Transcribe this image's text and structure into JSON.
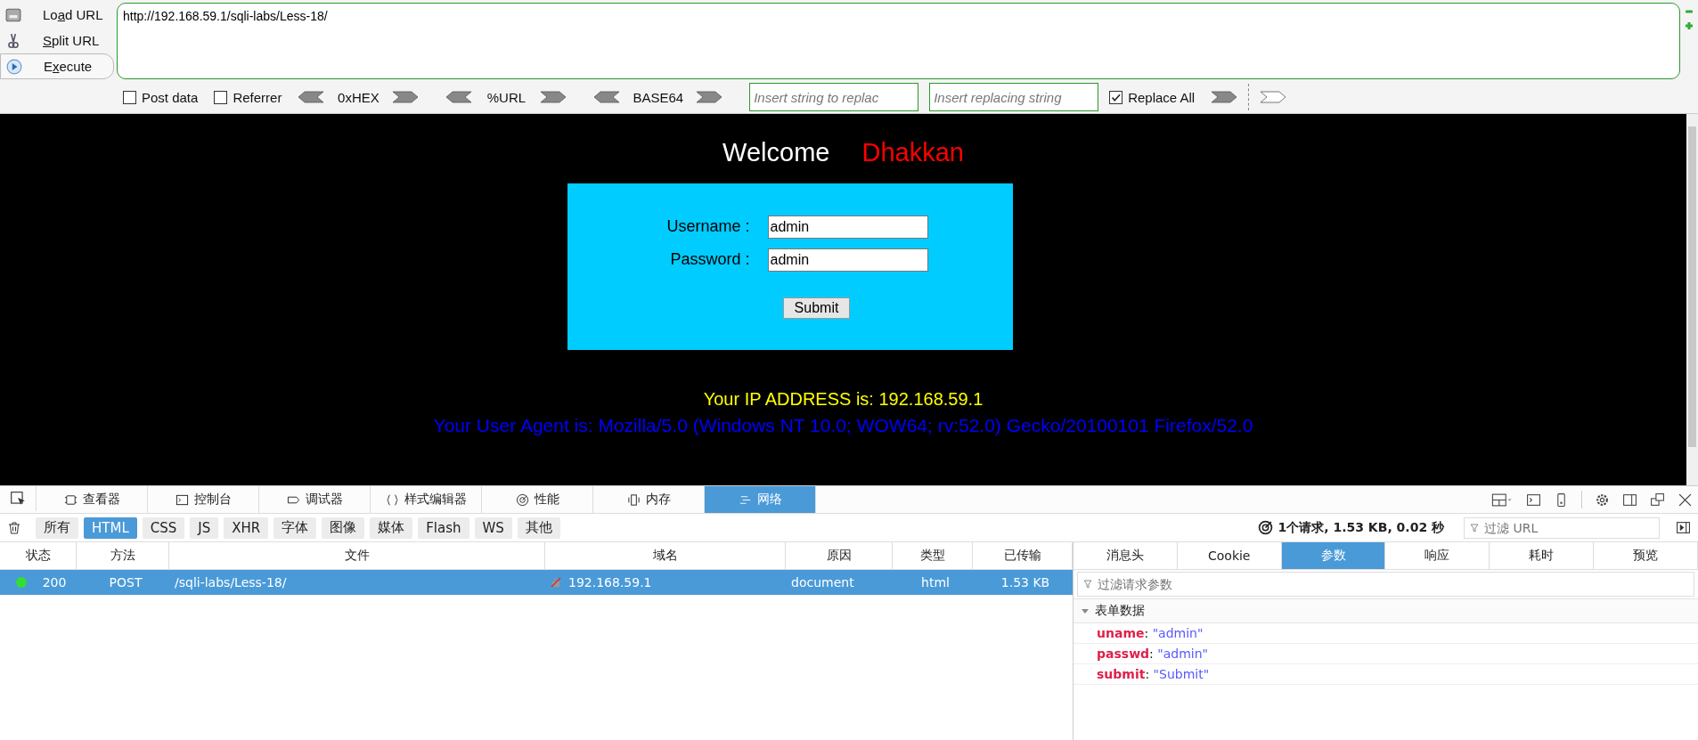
{
  "hackbar": {
    "actions": [
      {
        "kind": "load",
        "before_key": "Lo",
        "access_key": "a",
        "after_key": "d URL"
      },
      {
        "kind": "split",
        "access_key": "S",
        "after_key": "plit URL"
      },
      {
        "kind": "execute",
        "before_key": "E",
        "access_key": "x",
        "after_key": "ecute"
      }
    ],
    "url": "http://192.168.59.1/sqli-labs/Less-18/",
    "options": [
      {
        "label": "Post data",
        "checked": false
      },
      {
        "label": "Referrer",
        "checked": false
      }
    ],
    "encoders": [
      "0xHEX",
      "%URL",
      "BASE64"
    ],
    "replace_find": {
      "placeholder": "Insert string to replac"
    },
    "replace_with": {
      "placeholder": "Insert replacing string"
    },
    "replace_all": {
      "label": "Replace All",
      "checked": true
    }
  },
  "page": {
    "welcome": "Welcome",
    "name": "Dhakkan",
    "fields": [
      {
        "label": "Username :",
        "value": "admin"
      },
      {
        "label": "Password :",
        "value": "admin"
      }
    ],
    "submit": "Submit",
    "ip_line": "Your IP ADDRESS is: 192.168.59.1",
    "ua_line": "Your User Agent is: Mozilla/5.0 (Windows NT 10.0; WOW64; rv:52.0) Gecko/20100101 Firefox/52.0"
  },
  "devtools": {
    "tabs": [
      {
        "kind": "inspector",
        "label": "查看器",
        "selected": false
      },
      {
        "kind": "console",
        "label": "控制台",
        "selected": false
      },
      {
        "kind": "debugger",
        "label": "调试器",
        "selected": false
      },
      {
        "kind": "style",
        "label": "样式编辑器",
        "selected": false
      },
      {
        "kind": "performance",
        "label": "性能",
        "selected": false
      },
      {
        "kind": "memory",
        "label": "内存",
        "selected": false
      },
      {
        "kind": "network",
        "label": "网络",
        "selected": true
      }
    ],
    "filters": [
      {
        "label": "所有",
        "selected": false
      },
      {
        "label": "HTML",
        "selected": true
      },
      {
        "label": "CSS",
        "selected": false
      },
      {
        "label": "JS",
        "selected": false
      },
      {
        "label": "XHR",
        "selected": false
      },
      {
        "label": "字体",
        "selected": false
      },
      {
        "label": "图像",
        "selected": false
      },
      {
        "label": "媒体",
        "selected": false
      },
      {
        "label": "Flash",
        "selected": false
      },
      {
        "label": "WS",
        "selected": false
      },
      {
        "label": "其他",
        "selected": false
      }
    ],
    "summary": "1个请求, 1.53 KB, 0.02 秒",
    "url_filter": {
      "placeholder": "过滤 URL"
    },
    "columns": [
      "状态",
      "方法",
      "文件",
      "域名",
      "原因",
      "类型",
      "已传输"
    ],
    "rows": [
      {
        "color": "#33dd33",
        "status": "200",
        "method": "POST",
        "file": "/sqli-labs/Less-18/",
        "domain": "192.168.59.1",
        "cause": "document",
        "type": "html",
        "transferred": "1.53 KB",
        "selected": true
      }
    ],
    "detail_tabs": [
      {
        "label": "消息头",
        "selected": false
      },
      {
        "label": "Cookie",
        "selected": false
      },
      {
        "label": "参数",
        "selected": true
      },
      {
        "label": "响应",
        "selected": false
      },
      {
        "label": "耗时",
        "selected": false
      },
      {
        "label": "预览",
        "selected": false
      }
    ],
    "params_filter": {
      "placeholder": "过滤请求参数"
    },
    "section": {
      "label": "表单数据",
      "expanded": true
    },
    "params": [
      {
        "name": "uname",
        "sep": ":",
        "value": "\"admin\""
      },
      {
        "name": "passwd",
        "sep": ":",
        "value": "\"admin\""
      },
      {
        "name": "submit",
        "sep": ":",
        "value": "\"Submit\""
      }
    ]
  }
}
